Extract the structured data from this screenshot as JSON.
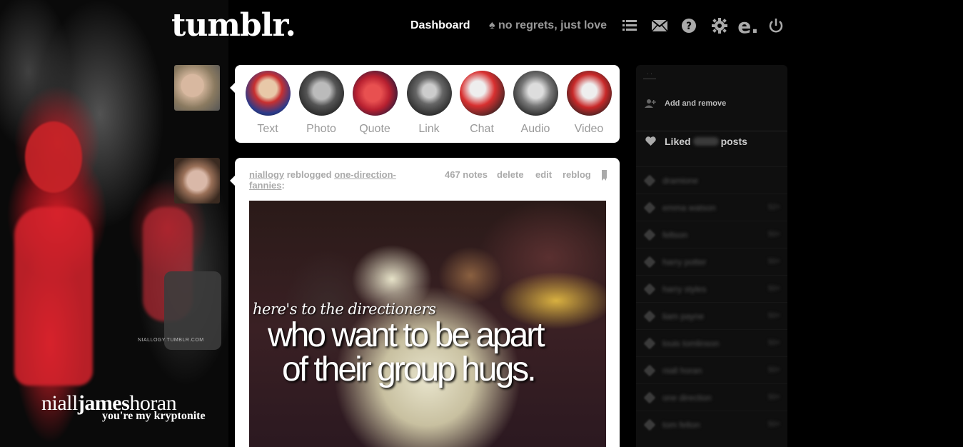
{
  "header": {
    "logo": "tumblr.",
    "dashboard": "Dashboard",
    "blog_name": "♠ no regrets, just love",
    "icons": [
      "list-icon",
      "mail-icon",
      "help-icon",
      "gear-icon",
      "e-icon",
      "power-icon"
    ],
    "e_glyph": "e."
  },
  "background": {
    "watermark": "NIALLOGY.TUMBLR.COM",
    "name_part1": "niall",
    "name_part2": "james",
    "name_part3": "horan",
    "tagline": "you're my kryptonite"
  },
  "post_types": [
    {
      "label": "Text"
    },
    {
      "label": "Photo"
    },
    {
      "label": "Quote"
    },
    {
      "label": "Link"
    },
    {
      "label": "Chat"
    },
    {
      "label": "Audio"
    },
    {
      "label": "Video"
    }
  ],
  "post": {
    "author": "niallogy",
    "action": " reblogged ",
    "source": "one-direction-fannies",
    "colon": ":",
    "notes": "467 notes",
    "delete": "delete",
    "edit": "edit",
    "reblog": "reblog",
    "caption_line1": "here's to the directioners",
    "caption_line2": "who want to be apart",
    "caption_line3": "of their group hugs."
  },
  "sidebar": {
    "add_remove": "Add and remove",
    "liked_prefix": "Liked",
    "liked_suffix": "posts",
    "tags": [
      {
        "name": "dramione",
        "count": ""
      },
      {
        "name": "emma watson",
        "count": "52+"
      },
      {
        "name": "feltson",
        "count": "50+"
      },
      {
        "name": "harry potter",
        "count": "50+"
      },
      {
        "name": "harry styles",
        "count": "50+"
      },
      {
        "name": "liam payne",
        "count": "50+"
      },
      {
        "name": "louis tomlinson",
        "count": "50+"
      },
      {
        "name": "niall horan",
        "count": "50+"
      },
      {
        "name": "one direction",
        "count": "50+"
      },
      {
        "name": "tom felton",
        "count": "50+"
      }
    ]
  },
  "colors": {
    "background": "#000000",
    "card": "#ffffff",
    "muted_text": "#999999",
    "accent_red": "#d82830"
  }
}
